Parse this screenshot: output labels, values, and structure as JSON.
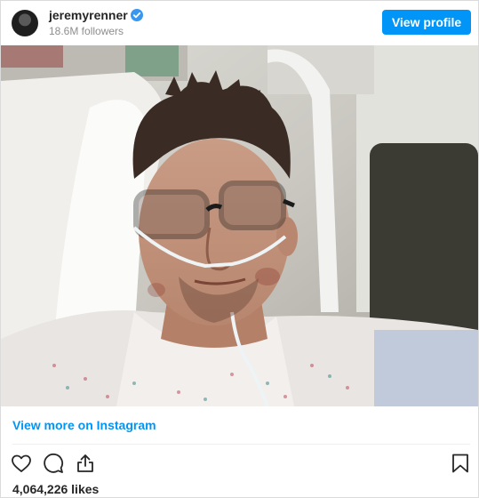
{
  "post": {
    "username": "jeremyrenner",
    "followers": "18.6M followers",
    "view_profile_label": "View profile",
    "view_more_label": "View more on Instagram",
    "likes": "4,064,226 likes",
    "verified": true
  },
  "icons": {
    "verified": "verified-badge-icon",
    "like": "heart-icon",
    "comment": "comment-icon",
    "share": "share-icon",
    "save": "bookmark-icon"
  },
  "colors": {
    "accent": "#0095f6",
    "text": "#262626",
    "muted": "#8e8e8e",
    "border": "#dbdbdb"
  }
}
